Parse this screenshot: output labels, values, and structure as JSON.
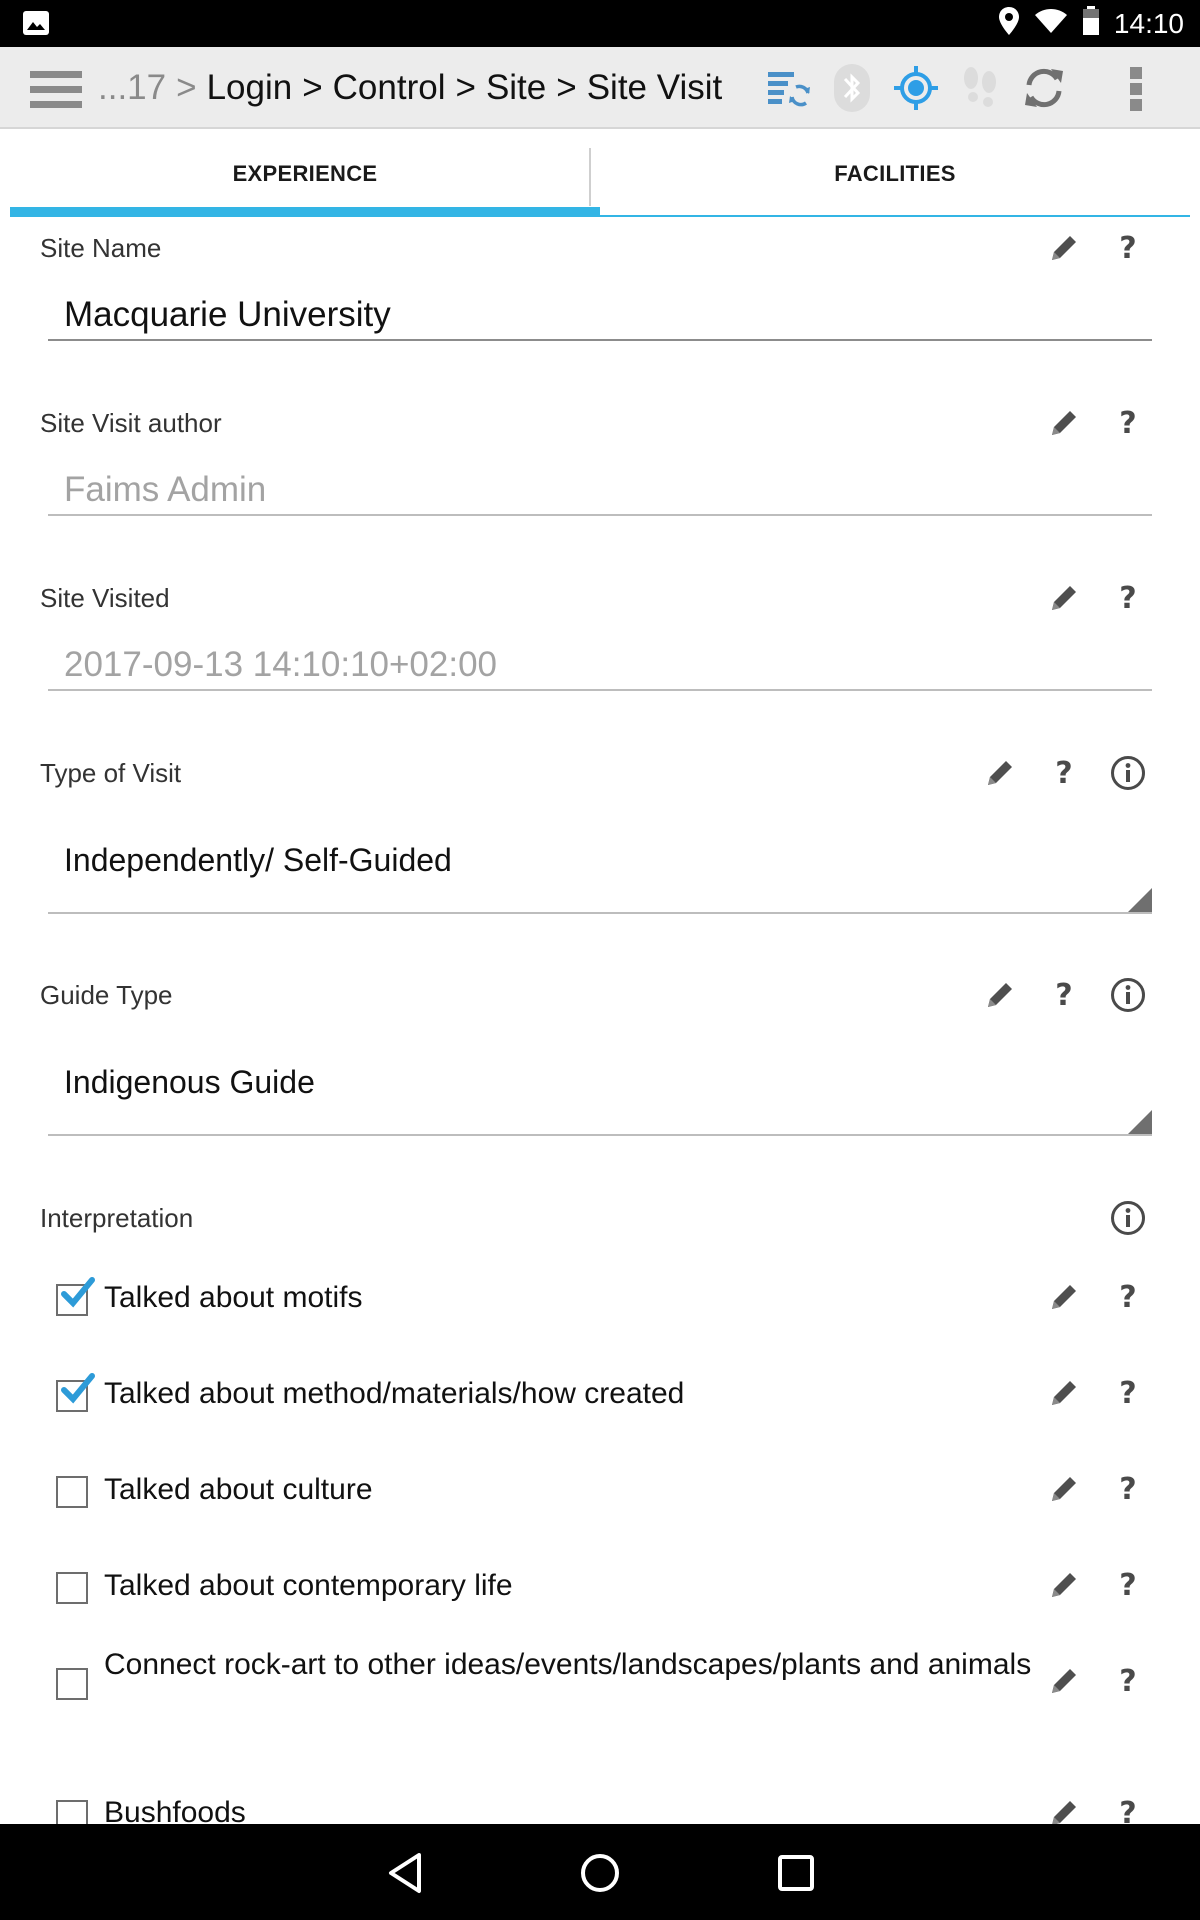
{
  "status_bar": {
    "time": "14:10",
    "icons": [
      "image-icon",
      "location-icon",
      "wifi-icon",
      "battery-icon"
    ]
  },
  "action_bar": {
    "breadcrumb": {
      "ellipsis": "...17",
      "items": [
        "Login",
        "Control",
        "Site",
        "Site Visit"
      ],
      "separator": ">"
    },
    "icons": [
      "sync-settings-icon",
      "bluetooth-icon",
      "gps-icon",
      "tracking-footsteps-icon",
      "refresh-icon",
      "overflow-menu-icon"
    ],
    "colors": {
      "accent": "#33b5e5",
      "inactive_icon": "#d9d9d9"
    }
  },
  "tabs": [
    {
      "label": "EXPERIENCE",
      "active": true
    },
    {
      "label": "FACILITIES",
      "active": false
    }
  ],
  "form": {
    "site_name": {
      "label": "Site Name",
      "value": "Macquarie University"
    },
    "site_visit_author": {
      "label": "Site Visit author",
      "value": "Faims Admin"
    },
    "site_visited": {
      "label": "Site Visited",
      "value": "2017-09-13 14:10:10+02:00"
    },
    "type_of_visit": {
      "label": "Type of Visit",
      "value": "Independently/ Self-Guided"
    },
    "guide_type": {
      "label": "Guide Type",
      "value": "Indigenous Guide"
    },
    "interpretation": {
      "label": "Interpretation",
      "items": [
        {
          "label": "Talked about motifs",
          "checked": true
        },
        {
          "label": "Talked about method/materials/how created",
          "checked": true
        },
        {
          "label": "Talked about culture",
          "checked": false
        },
        {
          "label": "Talked about contemporary life",
          "checked": false
        },
        {
          "label": "Connect rock-art to other ideas/events/landscapes/plants and animals",
          "checked": false
        },
        {
          "label": "Bushfoods",
          "checked": false
        }
      ]
    }
  },
  "help_glyph": "?"
}
